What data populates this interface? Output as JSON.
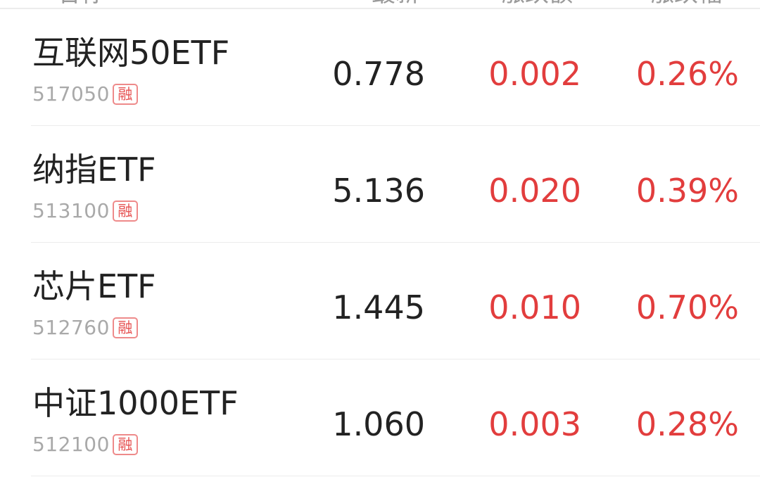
{
  "columns": {
    "name": "名称",
    "price": "最新",
    "change": "涨跌额",
    "pct": "涨跌幅"
  },
  "rows": [
    {
      "name": "互联网50ETF",
      "code": "517050",
      "badge": "融",
      "price": "0.778",
      "change": "0.002",
      "pct": "0.26%"
    },
    {
      "name": "纳指ETF",
      "code": "513100",
      "badge": "融",
      "price": "5.136",
      "change": "0.020",
      "pct": "0.39%"
    },
    {
      "name": "芯片ETF",
      "code": "512760",
      "badge": "融",
      "price": "1.445",
      "change": "0.010",
      "pct": "0.70%"
    },
    {
      "name": "中证1000ETF",
      "code": "512100",
      "badge": "融",
      "price": "1.060",
      "change": "0.003",
      "pct": "0.28%"
    }
  ],
  "colors": {
    "up": "#e23d3d",
    "text": "#222222",
    "muted": "#a9a9a9",
    "divider": "#ececec"
  }
}
